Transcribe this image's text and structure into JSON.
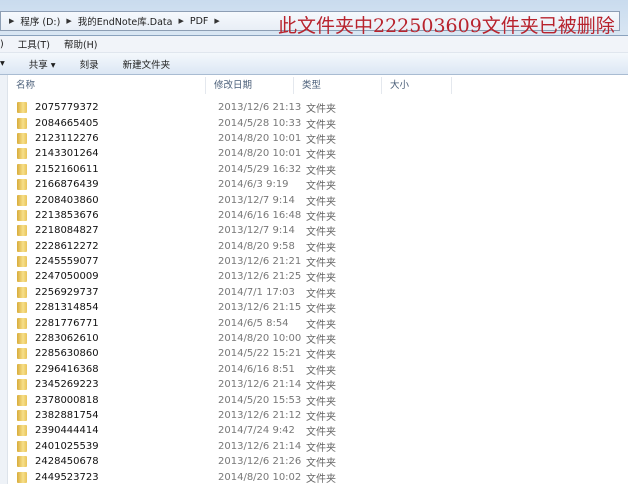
{
  "breadcrumb": [
    "程序 (D:)",
    "我的EndNote库.Data",
    "PDF"
  ],
  "notice": "此文件夹中222503609文件夹已被删除",
  "menu": [
    ")",
    "工具(T)",
    "帮助(H)"
  ],
  "toolbar": [
    "▾",
    "共享 ▾",
    "刻录",
    "新建文件夹"
  ],
  "columns": {
    "name": "名称",
    "date": "修改日期",
    "type": "类型",
    "size": "大小"
  },
  "rows": [
    {
      "name": "2075779372",
      "date": "2013/12/6 21:13",
      "type": "文件夹"
    },
    {
      "name": "2084665405",
      "date": "2014/5/28 10:33",
      "type": "文件夹"
    },
    {
      "name": "2123112276",
      "date": "2014/8/20 10:01",
      "type": "文件夹"
    },
    {
      "name": "2143301264",
      "date": "2014/8/20 10:01",
      "type": "文件夹"
    },
    {
      "name": "2152160611",
      "date": "2014/5/29 16:32",
      "type": "文件夹"
    },
    {
      "name": "2166876439",
      "date": "2014/6/3 9:19",
      "type": "文件夹"
    },
    {
      "name": "2208403860",
      "date": "2013/12/7 9:14",
      "type": "文件夹"
    },
    {
      "name": "2213853676",
      "date": "2014/6/16 16:48",
      "type": "文件夹"
    },
    {
      "name": "2218084827",
      "date": "2013/12/7 9:14",
      "type": "文件夹"
    },
    {
      "name": "2228612272",
      "date": "2014/8/20 9:58",
      "type": "文件夹"
    },
    {
      "name": "2245559077",
      "date": "2013/12/6 21:21",
      "type": "文件夹"
    },
    {
      "name": "2247050009",
      "date": "2013/12/6 21:25",
      "type": "文件夹"
    },
    {
      "name": "2256929737",
      "date": "2014/7/1 17:03",
      "type": "文件夹"
    },
    {
      "name": "2281314854",
      "date": "2013/12/6 21:15",
      "type": "文件夹"
    },
    {
      "name": "2281776771",
      "date": "2014/6/5 8:54",
      "type": "文件夹"
    },
    {
      "name": "2283062610",
      "date": "2014/8/20 10:00",
      "type": "文件夹"
    },
    {
      "name": "2285630860",
      "date": "2014/5/22 15:21",
      "type": "文件夹"
    },
    {
      "name": "2296416368",
      "date": "2014/6/16 8:51",
      "type": "文件夹"
    },
    {
      "name": "2345269223",
      "date": "2013/12/6 21:14",
      "type": "文件夹"
    },
    {
      "name": "2378000818",
      "date": "2014/5/20 15:53",
      "type": "文件夹"
    },
    {
      "name": "2382881754",
      "date": "2013/12/6 21:12",
      "type": "文件夹"
    },
    {
      "name": "2390444414",
      "date": "2014/7/24 9:42",
      "type": "文件夹"
    },
    {
      "name": "2401025539",
      "date": "2013/12/6 21:14",
      "type": "文件夹"
    },
    {
      "name": "2428450678",
      "date": "2013/12/6 21:26",
      "type": "文件夹"
    },
    {
      "name": "2449523723",
      "date": "2014/8/20 10:02",
      "type": "文件夹"
    }
  ]
}
